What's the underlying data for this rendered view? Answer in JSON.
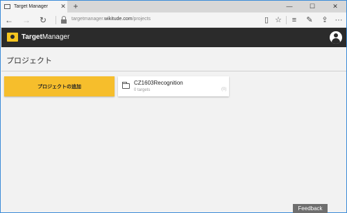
{
  "browser": {
    "tab_title": "Target Manager",
    "tab_close": "✕",
    "new_tab": "+",
    "window_controls": {
      "minimize": "—",
      "maximize": "☐",
      "close": "✕"
    },
    "nav": {
      "back": "←",
      "forward": "→",
      "refresh": "↻"
    },
    "url_prefix": "targetmanager.",
    "url_domain": "wikitude.com",
    "url_path": "/projects",
    "toolbar": {
      "reading_view": "▯",
      "favorite": "☆",
      "hub": "≡",
      "notes": "✎",
      "share": "⇪",
      "more": "···"
    }
  },
  "app": {
    "brand_first": "Target",
    "brand_second": "Manager"
  },
  "page": {
    "title": "プロジェクト",
    "add_button_label": "プロジェクトの追加"
  },
  "projects": [
    {
      "name": "CZ1603Recognition",
      "targets": "0 targets",
      "badge": "(0)"
    }
  ],
  "feedback_label": "Feedback"
}
